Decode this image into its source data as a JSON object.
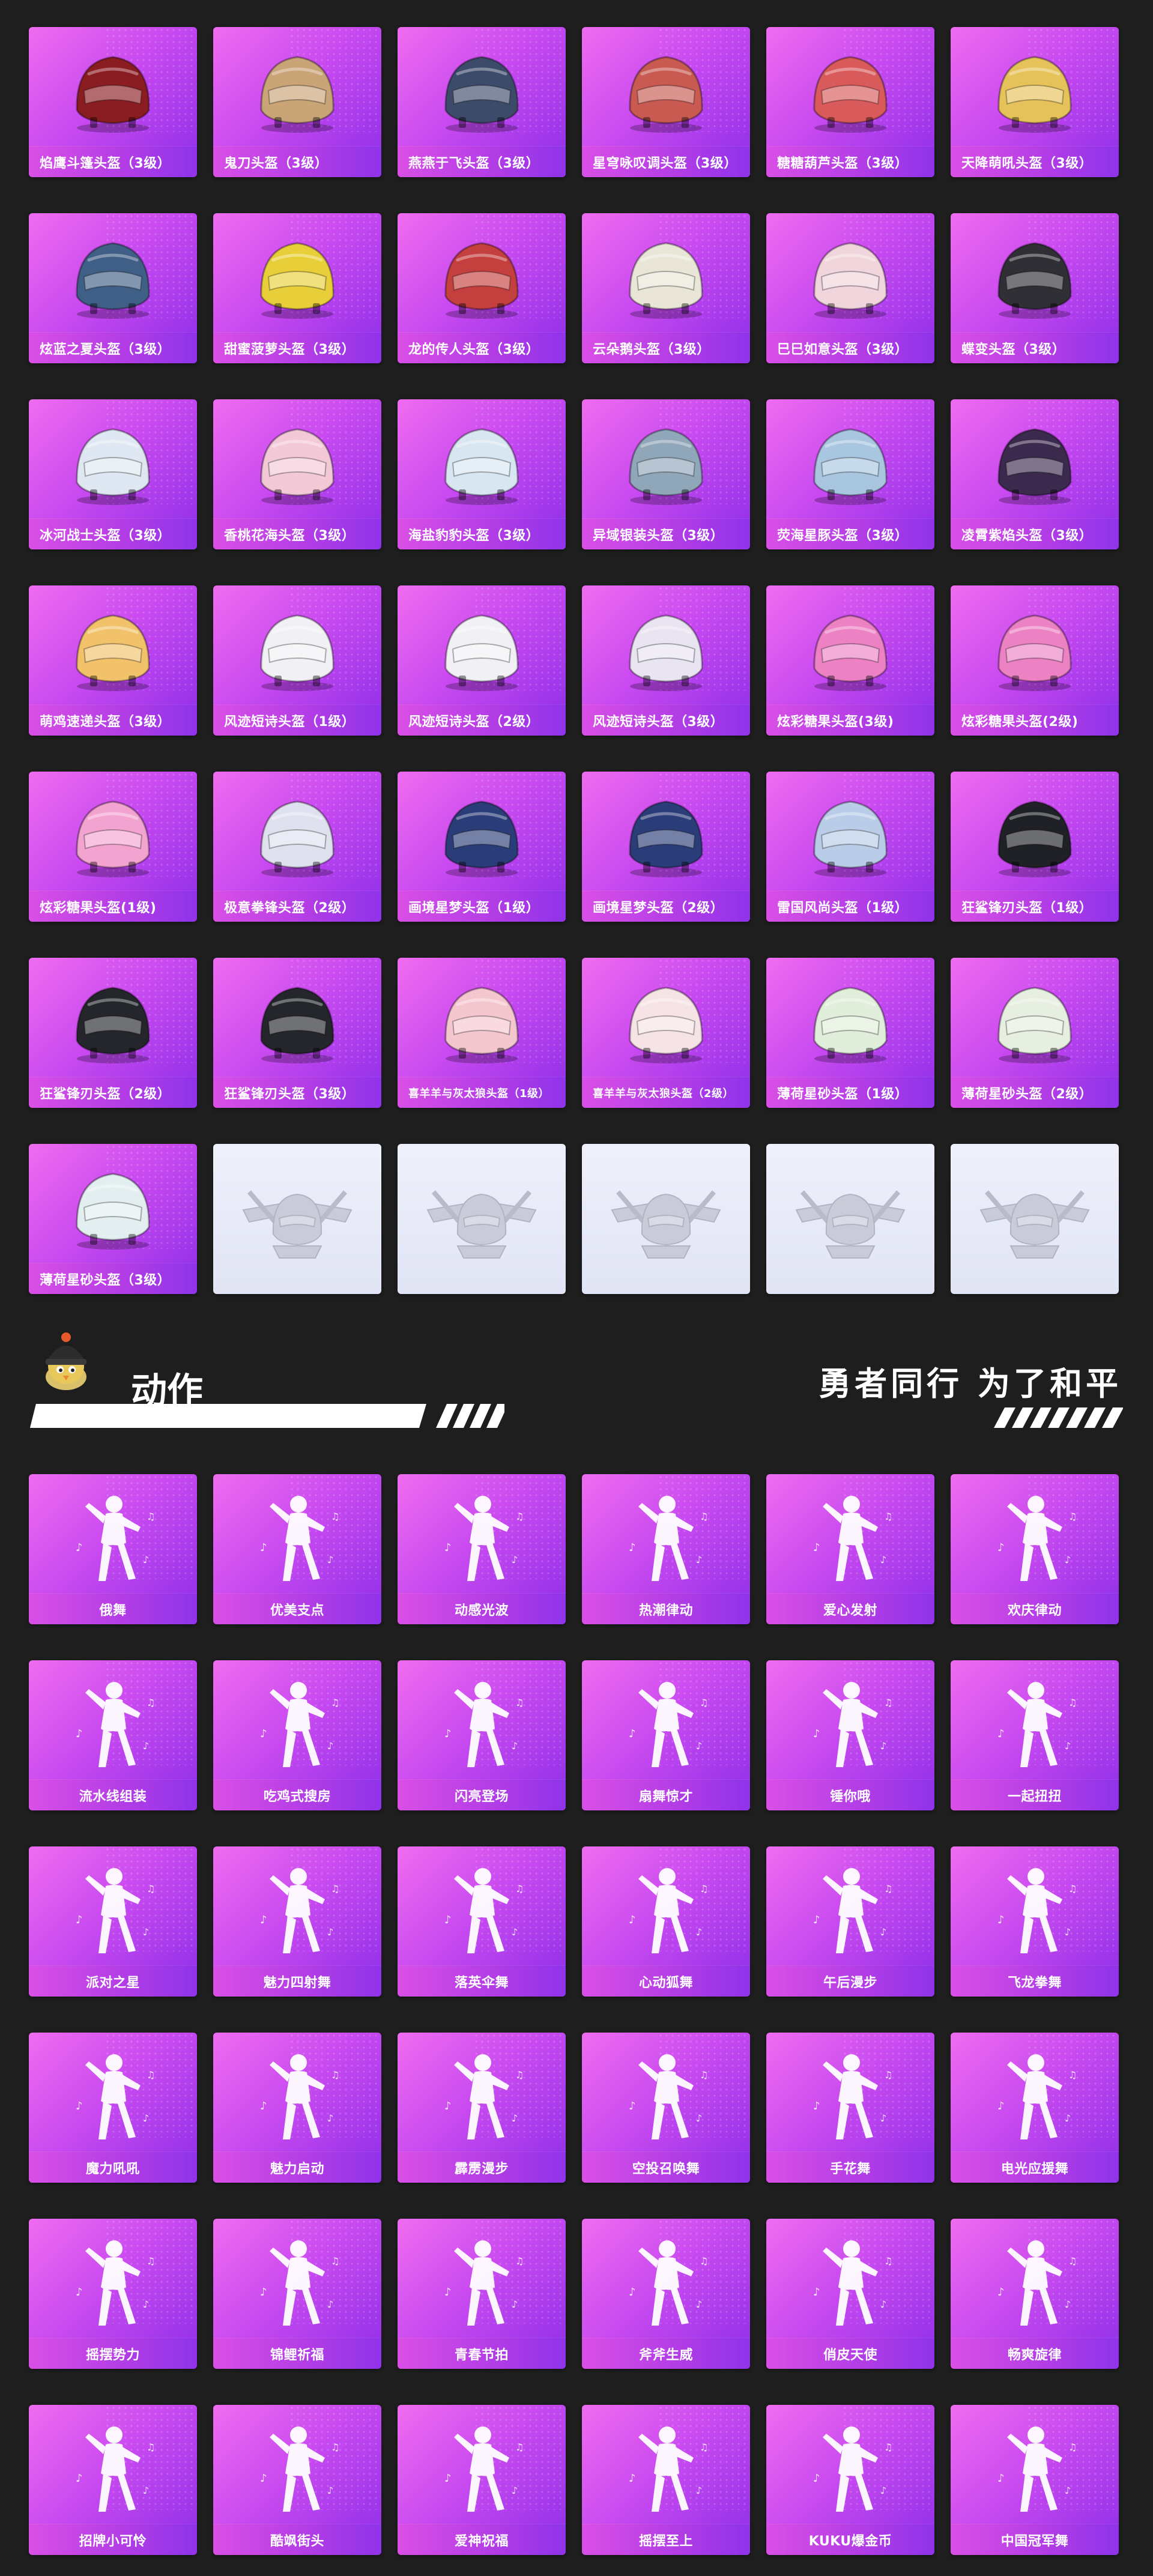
{
  "helmets": [
    {
      "label": "焰鹰斗篷头盔（3级）",
      "color": "#8a1d22"
    },
    {
      "label": "鬼刀头盔（3级）",
      "color": "#c9a477"
    },
    {
      "label": "燕燕于飞头盔（3级）",
      "color": "#3d4b6b"
    },
    {
      "label": "星穹咏叹调头盔（3级）",
      "color": "#c85a52"
    },
    {
      "label": "糖糖葫芦头盔（3级）",
      "color": "#d85a5a"
    },
    {
      "label": "天降萌吼头盔（3级）",
      "color": "#e6c25a"
    },
    {
      "label": "炫蓝之夏头盔（3级）",
      "color": "#3f5f86"
    },
    {
      "label": "甜蜜菠萝头盔（3级）",
      "color": "#e8cf3a"
    },
    {
      "label": "龙的传人头盔（3级）",
      "color": "#c4403e"
    },
    {
      "label": "云朵鹅头盔（3级）",
      "color": "#e9e6d8"
    },
    {
      "label": "巳巳如意头盔（3级）",
      "color": "#f0d5dc"
    },
    {
      "label": "蝶变头盔（3级）",
      "color": "#2f2f35"
    },
    {
      "label": "冰河战士头盔（3级）",
      "color": "#dfe8f2"
    },
    {
      "label": "香桃花海头盔（3级）",
      "color": "#f3c9d8"
    },
    {
      "label": "海盐豹豹头盔（3级）",
      "color": "#d7e6f0"
    },
    {
      "label": "异域银装头盔（3级）",
      "color": "#8fa7b8"
    },
    {
      "label": "荧海星豚头盔（3级）",
      "color": "#a9c6e0"
    },
    {
      "label": "凌霄紫焰头盔（3级）",
      "color": "#3b2a4e"
    },
    {
      "label": "萌鸡速递头盔（3级）",
      "color": "#f2c26b"
    },
    {
      "label": "风迹短诗头盔（1级）",
      "color": "#f1f1f5"
    },
    {
      "label": "风迹短诗头盔（2级）",
      "color": "#f1f1f5"
    },
    {
      "label": "风迹短诗头盔（3级）",
      "color": "#e9e4f1"
    },
    {
      "label": "炫彩糖果头盔(3级)",
      "color": "#ec82c4"
    },
    {
      "label": "炫彩糖果头盔(2级)",
      "color": "#ec82c4"
    },
    {
      "label": "炫彩糖果头盔(1级)",
      "color": "#f3a3cf"
    },
    {
      "label": "极意拳锋头盔（2级）",
      "color": "#dfe1ee"
    },
    {
      "label": "画境星梦头盔（1级）",
      "color": "#2b3d78"
    },
    {
      "label": "画境星梦头盔（2级）",
      "color": "#2b3d78"
    },
    {
      "label": "雷国风尚头盔（1级）",
      "color": "#b9cde8"
    },
    {
      "label": "狂鲨锋刃头盔（1级）",
      "color": "#1f2126"
    },
    {
      "label": "狂鲨锋刃头盔（2级）",
      "color": "#24262c"
    },
    {
      "label": "狂鲨锋刃头盔（3级）",
      "color": "#24262c"
    },
    {
      "label": "喜羊羊与灰太狼头盔（1级）",
      "color": "#f4c7cf"
    },
    {
      "label": "喜羊羊与灰太狼头盔（2级）",
      "color": "#f6e3e6"
    },
    {
      "label": "薄荷星砂头盔（1级）",
      "color": "#e2eedc"
    },
    {
      "label": "薄荷星砂头盔（2级）",
      "color": "#e6efe0"
    },
    {
      "label": "薄荷星砂头盔（3级）",
      "color": "#e3eef0"
    }
  ],
  "placeholder_count": 5,
  "section": {
    "title": "动作",
    "slogan": "勇者同行 为了和平"
  },
  "emotes": [
    {
      "label": "俄舞",
      "icon": "dance-pose-icon"
    },
    {
      "label": "优美支点",
      "icon": "dance-pose-icon"
    },
    {
      "label": "动感光波",
      "icon": "dance-pose-icon"
    },
    {
      "label": "热潮律动",
      "icon": "dance-pose-icon"
    },
    {
      "label": "爱心发射",
      "icon": "heart-pose-icon"
    },
    {
      "label": "欢庆律动",
      "icon": "dance-pose-icon"
    },
    {
      "label": "流水线组装",
      "icon": "dance-pose-icon"
    },
    {
      "label": "吃鸡式搜房",
      "icon": "gun-pose-icon"
    },
    {
      "label": "闪亮登场",
      "icon": "spotlight-pose-icon"
    },
    {
      "label": "扇舞惊才",
      "icon": "fan-pose-icon"
    },
    {
      "label": "锤你哦",
      "icon": "hammer-pose-icon"
    },
    {
      "label": "一起扭扭",
      "icon": "dance-pose-icon"
    },
    {
      "label": "派对之星",
      "icon": "dance-pose-icon"
    },
    {
      "label": "魅力四射舞",
      "icon": "dance-pose-icon"
    },
    {
      "label": "落英伞舞",
      "icon": "umbrella-pose-icon"
    },
    {
      "label": "心动狐舞",
      "icon": "fox-pose-icon"
    },
    {
      "label": "午后漫步",
      "icon": "dance-pose-icon"
    },
    {
      "label": "飞龙拳舞",
      "icon": "dragon-pose-icon"
    },
    {
      "label": "魔力吼吼",
      "icon": "dance-pose-icon"
    },
    {
      "label": "魅力启动",
      "icon": "dance-pose-icon"
    },
    {
      "label": "霹雳漫步",
      "icon": "dance-pose-icon"
    },
    {
      "label": "空投召唤舞",
      "icon": "dance-pose-icon"
    },
    {
      "label": "手花舞",
      "icon": "dance-pose-icon"
    },
    {
      "label": "电光应援舞",
      "icon": "lightstick-pose-icon"
    },
    {
      "label": "摇摆势力",
      "icon": "dance-pose-icon"
    },
    {
      "label": "锦鲤祈福",
      "icon": "koi-pose-icon"
    },
    {
      "label": "青春节拍",
      "icon": "dance-pose-icon"
    },
    {
      "label": "斧斧生威",
      "icon": "axe-pose-icon"
    },
    {
      "label": "俏皮天使",
      "icon": "dance-pose-icon"
    },
    {
      "label": "畅爽旋律",
      "icon": "dance-pose-icon"
    },
    {
      "label": "招牌小可怜",
      "icon": "sign-pose-icon"
    },
    {
      "label": "酷飒街头",
      "icon": "dance-pose-icon"
    },
    {
      "label": "爱神祝福",
      "icon": "cupid-pose-icon"
    },
    {
      "label": "摇摆至上",
      "icon": "dance-pose-icon"
    },
    {
      "label": "KUKU爆金币",
      "icon": "money-pose-icon"
    },
    {
      "label": "中国冠军舞",
      "icon": "dance-pose-icon"
    }
  ],
  "colors": {
    "background": "#1e1e1e",
    "card_gradient_start": "#ef6cf0",
    "card_gradient_end": "#8d2ee8",
    "label_bar": "#b03ce6",
    "placeholder": "#e6e9f6"
  }
}
